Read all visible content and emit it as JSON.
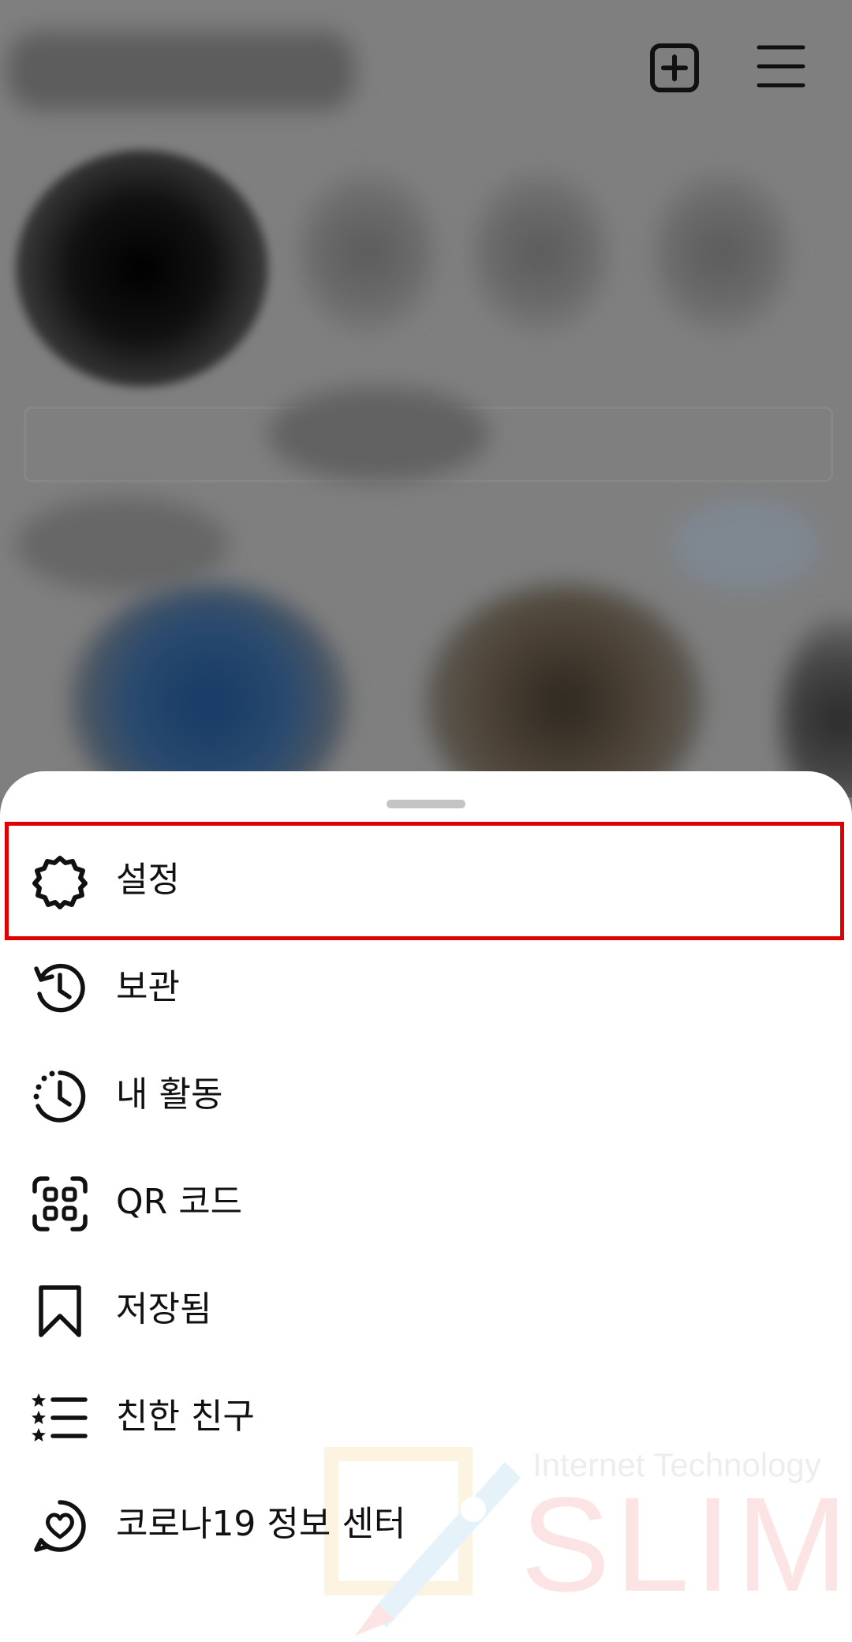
{
  "header": {
    "new_post_icon": "plus-square-icon",
    "menu_icon": "hamburger-menu-icon"
  },
  "menu": {
    "items": [
      {
        "id": "settings",
        "label": "설정",
        "icon": "gear-icon",
        "highlighted": true
      },
      {
        "id": "archive",
        "label": "보관",
        "icon": "history-icon"
      },
      {
        "id": "your-activity",
        "label": "내 활동",
        "icon": "activity-clock-icon"
      },
      {
        "id": "qr-code",
        "label": "QR 코드",
        "icon": "qr-scan-icon"
      },
      {
        "id": "saved",
        "label": "저장됨",
        "icon": "bookmark-icon"
      },
      {
        "id": "close-friends",
        "label": "친한 친구",
        "icon": "star-list-icon"
      },
      {
        "id": "covid-center",
        "label": "코로나19 정보 센터",
        "icon": "heart-chat-icon"
      }
    ]
  },
  "watermark": {
    "subtitle": "Internet Technology",
    "brand": "SLIM"
  },
  "colors": {
    "highlight": "#e00000",
    "text": "#111111",
    "sheet_bg": "#ffffff",
    "overlay": "#7f7f7f"
  }
}
